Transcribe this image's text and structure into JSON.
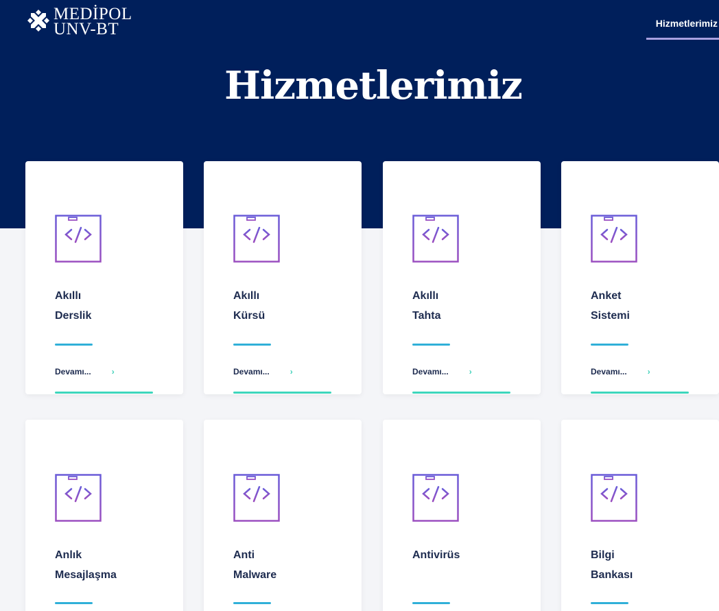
{
  "header": {
    "logo_line1": "MEDİPOL",
    "logo_line2": "UNV-BT",
    "nav_active": "Hizmetlerimiz",
    "title": "Hizmetlerimiz"
  },
  "colors": {
    "hero_bg": "#001f5b",
    "icon_purple": "#7b4fc8",
    "divider_blue": "#30b0d8",
    "accent_teal": "#3dd6bc"
  },
  "cards": [
    {
      "title": "Akıllı\nDerslik",
      "icon": "code-window-icon",
      "more": "Devamı...",
      "more_icon": "chevron-right-icon"
    },
    {
      "title": "Akıllı\nKürsü",
      "icon": "code-window-icon",
      "more": "Devamı...",
      "more_icon": "chevron-right-icon"
    },
    {
      "title": "Akıllı\nTahta",
      "icon": "code-window-icon",
      "more": "Devamı...",
      "more_icon": "chevron-right-icon"
    },
    {
      "title": "Anket\nSistemi",
      "icon": "code-window-icon",
      "more": "Devamı...",
      "more_icon": "chevron-right-icon"
    },
    {
      "title": "Anlık\nMesajlaşma",
      "icon": "code-window-icon"
    },
    {
      "title": "Anti\nMalware",
      "icon": "code-window-icon"
    },
    {
      "title": "Antivirüs",
      "icon": "code-window-icon"
    },
    {
      "title": "Bilgi\nBankası",
      "icon": "code-window-icon"
    }
  ]
}
